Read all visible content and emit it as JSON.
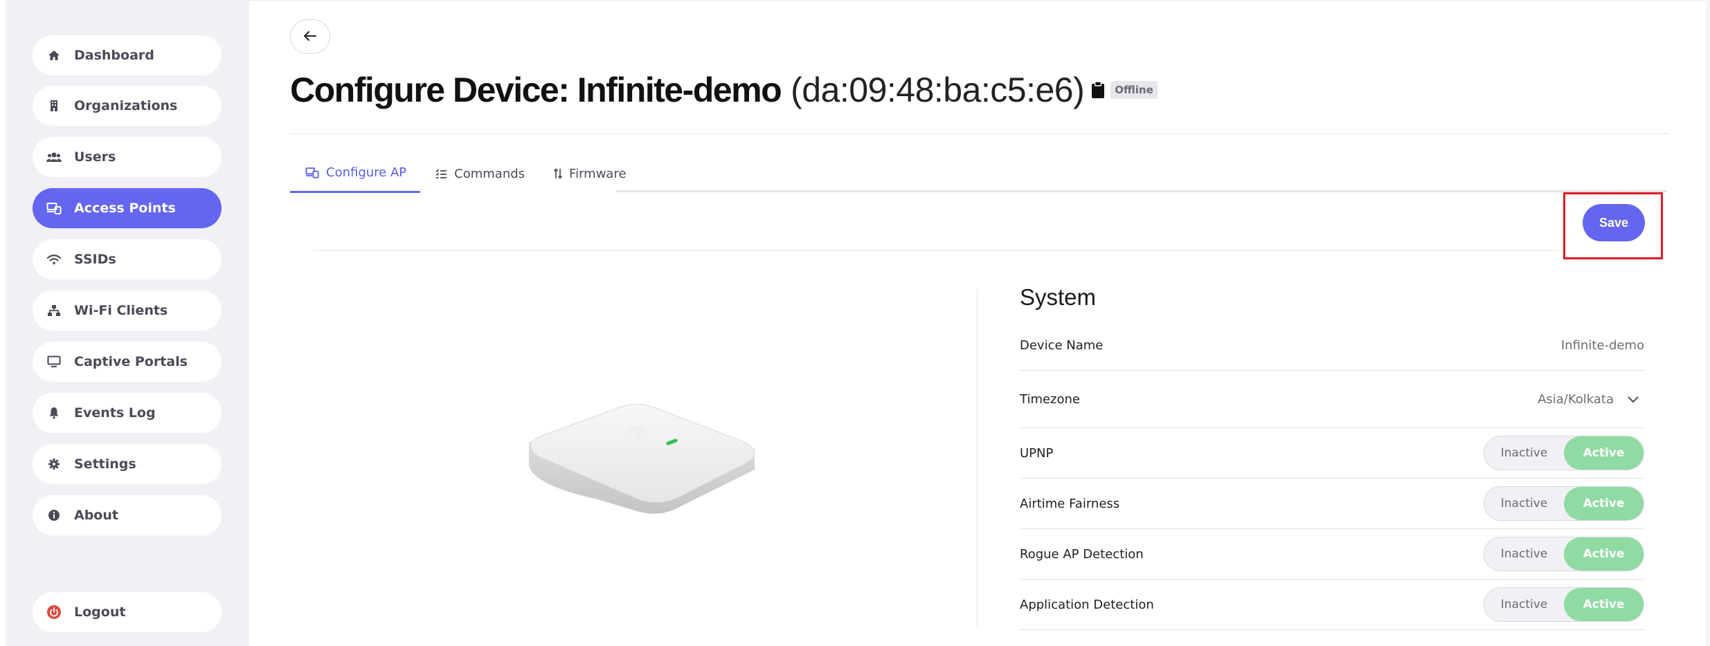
{
  "sidebar": {
    "items": [
      {
        "label": "Dashboard",
        "icon": "home-icon"
      },
      {
        "label": "Organizations",
        "icon": "building-icon"
      },
      {
        "label": "Users",
        "icon": "users-icon"
      },
      {
        "label": "Access Points",
        "icon": "devices-icon",
        "active": true
      },
      {
        "label": "SSIDs",
        "icon": "wifi-icon"
      },
      {
        "label": "Wi-Fi Clients",
        "icon": "network-icon"
      },
      {
        "label": "Captive Portals",
        "icon": "monitor-icon"
      },
      {
        "label": "Events Log",
        "icon": "bell-icon"
      },
      {
        "label": "Settings",
        "icon": "gear-icon"
      },
      {
        "label": "About",
        "icon": "info-icon"
      }
    ],
    "logout_label": "Logout"
  },
  "header": {
    "title": "Configure Device: Infinite-demo",
    "mac": "(da:09:48:ba:c5:e6)",
    "status": "Offline"
  },
  "tabs": [
    {
      "label": "Configure AP",
      "active": true
    },
    {
      "label": "Commands"
    },
    {
      "label": "Firmware"
    }
  ],
  "actions": {
    "save_label": "Save"
  },
  "system": {
    "title": "System",
    "device_name_label": "Device Name",
    "device_name_value": "Infinite-demo",
    "timezone_label": "Timezone",
    "timezone_value": "Asia/Kolkata",
    "toggles": [
      {
        "label": "UPNP",
        "off": "Inactive",
        "on": "Active",
        "state": "Active"
      },
      {
        "label": "Airtime Fairness",
        "off": "Inactive",
        "on": "Active",
        "state": "Active"
      },
      {
        "label": "Rogue AP Detection",
        "off": "Inactive",
        "on": "Active",
        "state": "Active"
      },
      {
        "label": "Application Detection",
        "off": "Inactive",
        "on": "Active",
        "state": "Active"
      }
    ]
  },
  "colors": {
    "accent": "#6466f0",
    "active_toggle": "#8fdba3",
    "highlight": "#e01c24"
  }
}
